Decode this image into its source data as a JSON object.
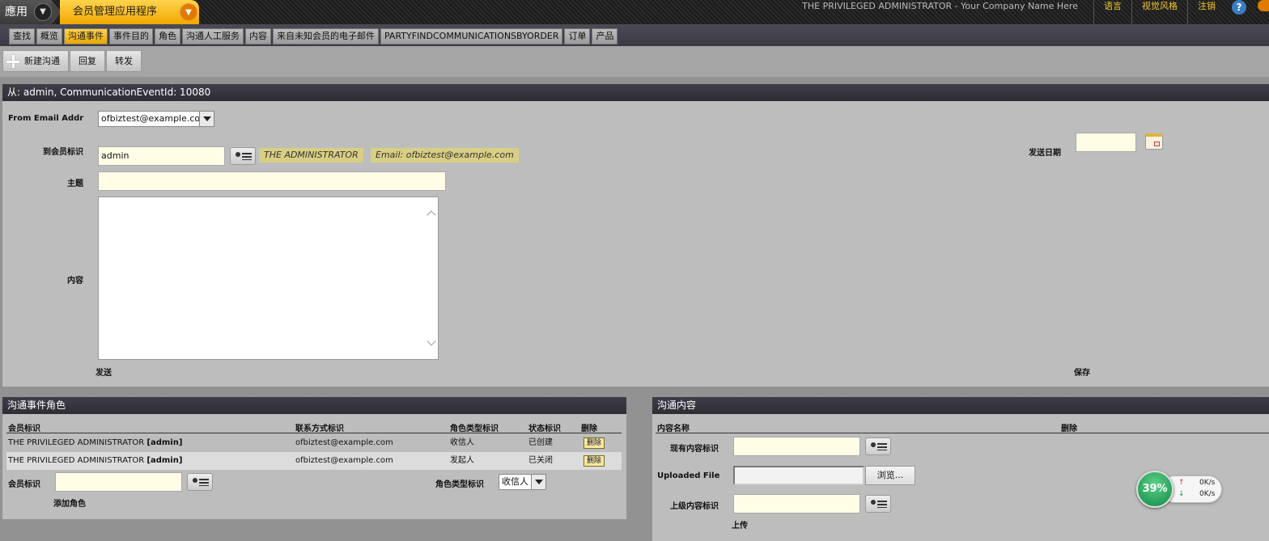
{
  "topbar": {
    "app_label": "應用",
    "app_name": "会员管理应用程序",
    "user_info": "THE PRIVILEGED ADMINISTRATOR - Your Company Name Here",
    "links": [
      "语言",
      "视觉风格",
      "注销"
    ],
    "help": "?"
  },
  "nav": {
    "tabs": [
      "查找",
      "概览",
      "沟通事件",
      "事件目的",
      "角色",
      "沟通人工服务",
      "内容",
      "来自未知会员的电子邮件",
      "PARTYFINDCOMMUNICATIONSBYORDER",
      "订单",
      "产品"
    ],
    "active_index": 2
  },
  "actions": {
    "new": "新建沟通",
    "reply": "回复",
    "forward": "转发"
  },
  "form": {
    "header": "从: admin, CommunicationEventId: 10080",
    "from_label": "From Email Addr",
    "from_value": "ofbiztest@example.com",
    "to_party_label": "到会员标识",
    "to_party_value": "admin",
    "party_name": "THE ADMINISTRATOR",
    "party_email": "Email: ofbiztest@example.com",
    "subject_label": "主题",
    "subject_value": "",
    "content_label": "内容",
    "send_date_label": "发送日期",
    "send": "发送",
    "save": "保存"
  },
  "roles": {
    "header": "沟通事件角色",
    "columns": [
      "会员标识",
      "联系方式标识",
      "角色类型标识",
      "状态标识",
      "删除"
    ],
    "rows": [
      {
        "party_name": "THE PRIVILEGED ADMINISTRATOR",
        "party_id": "[admin]",
        "contact": "ofbiztest@example.com",
        "role": "收信人",
        "status": "已创建",
        "delete": "删除"
      },
      {
        "party_name": "THE PRIVILEGED ADMINISTRATOR",
        "party_id": "[admin]",
        "contact": "ofbiztest@example.com",
        "role": "发起人",
        "status": "已关闭",
        "delete": "删除"
      }
    ],
    "party_label": "会员标识",
    "role_type_label": "角色类型标识",
    "role_type_value": "收信人",
    "add_role": "添加角色"
  },
  "content": {
    "header": "沟通内容",
    "columns": [
      "内容名称",
      "删除"
    ],
    "existing_label": "现有内容标识",
    "uploaded_label": "Uploaded File",
    "browse": "浏览...",
    "parent_label": "上级内容标识",
    "upload": "上传"
  },
  "network": {
    "percent": "39%",
    "up": "0K/s",
    "down": "0K/s",
    "up_arrow": "↑",
    "down_arrow": "↓"
  }
}
